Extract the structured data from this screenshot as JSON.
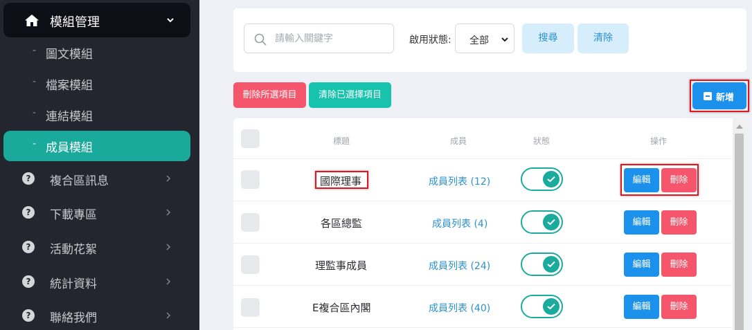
{
  "sidebar": {
    "header_title": "模組管理",
    "sub_items": [
      {
        "label": "圖文模組",
        "dash": "-"
      },
      {
        "label": "檔案模組",
        "dash": "-"
      },
      {
        "label": "連結模組",
        "dash": "-"
      },
      {
        "label": "成員模組",
        "dash": "-",
        "active": true
      }
    ],
    "menu_items": [
      {
        "label": "複合區訊息",
        "icon": "question-circle-icon"
      },
      {
        "label": "下載專區",
        "icon": "question-circle-icon"
      },
      {
        "label": "活動花絮",
        "icon": "question-circle-icon"
      },
      {
        "label": "統計資料",
        "icon": "question-circle-icon"
      },
      {
        "label": "聯絡我們",
        "icon": "question-circle-icon"
      }
    ]
  },
  "search": {
    "placeholder": "請輸入關鍵字",
    "status_label": "啟用狀態:",
    "status_value": "全部",
    "search_button": "搜尋",
    "clear_button": "清除"
  },
  "actions": {
    "delete_selected": "刪除所選項目",
    "clear_selected": "清除已選擇項目",
    "add": "新增"
  },
  "table": {
    "headers": {
      "title": "標題",
      "member": "成員",
      "status": "狀態",
      "actions": "操作"
    },
    "rows": [
      {
        "title": "國際理事",
        "member": "成員列表 (12)",
        "enabled": true,
        "edit": "編輯",
        "delete": "刪除"
      },
      {
        "title": "各區總監",
        "member": "成員列表 (4)",
        "enabled": true,
        "edit": "編輯",
        "delete": "刪除"
      },
      {
        "title": "理監事成員",
        "member": "成員列表 (24)",
        "enabled": true,
        "edit": "編輯",
        "delete": "刪除"
      },
      {
        "title": "E複合區內閣",
        "member": "成員列表 (40)",
        "enabled": true,
        "edit": "編輯",
        "delete": "刪除"
      }
    ]
  },
  "colors": {
    "sidebar_bg": "#23262e",
    "accent_teal": "#1aaa9c",
    "primary_blue": "#1b91ec",
    "danger_red": "#f5566b",
    "highlight_red": "#e0161e"
  }
}
